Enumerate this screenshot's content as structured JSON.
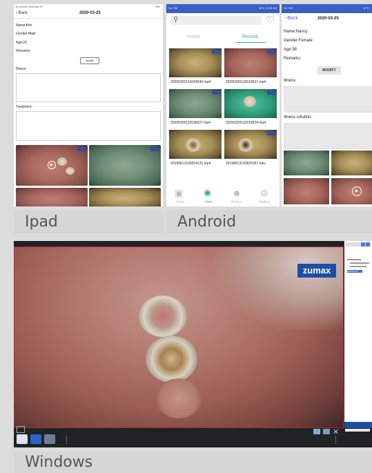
{
  "captions": {
    "ipad": "Ipad",
    "android": "Android",
    "windows": "Windows"
  },
  "ipad": {
    "status_left": "10:18 AM  Wed Mar 25",
    "status_right": "75%",
    "back": "Back",
    "date": "2020-03-25",
    "name": "Name:Kim",
    "gender": "Gender:Male",
    "age": "Age:20",
    "remarks": "Remarks:",
    "modify": "Modify",
    "illness": "Illness:",
    "treatment": "Treatment:",
    "brand_tag": "zumax"
  },
  "android": {
    "status_left": "No SIM",
    "status_right": "82%  11:05 AM",
    "tab_image": "Image",
    "tab_record": "Record",
    "videos": [
      "20200325110643540.mp4",
      "20200325110619537.mp4",
      "20200325110536527.mp4",
      "20200325110519524.mp4",
      "20190613193004131.mp4",
      "20190613192825357.mkv"
    ],
    "nav": [
      "Video",
      "View",
      "Patient",
      "Setting"
    ]
  },
  "android2": {
    "status_left": "No SIM",
    "status_right": "87%",
    "back": "Back",
    "date": "2020-03-25",
    "name": "Name:Nancy",
    "gender": "Gender:Female",
    "age": "Age:38",
    "remarks": "Remarks:",
    "modify": "MODIFY",
    "illness": "Illness:",
    "illness_solution": "Illness solution:"
  },
  "windows": {
    "logo": "zumax",
    "menu_icon": "menu-icon",
    "tree_selected": "2020-03-25"
  },
  "colors": {
    "android_blue": "#3a5fc6",
    "green": "#3fb27f",
    "win_dark": "#1f2326"
  }
}
